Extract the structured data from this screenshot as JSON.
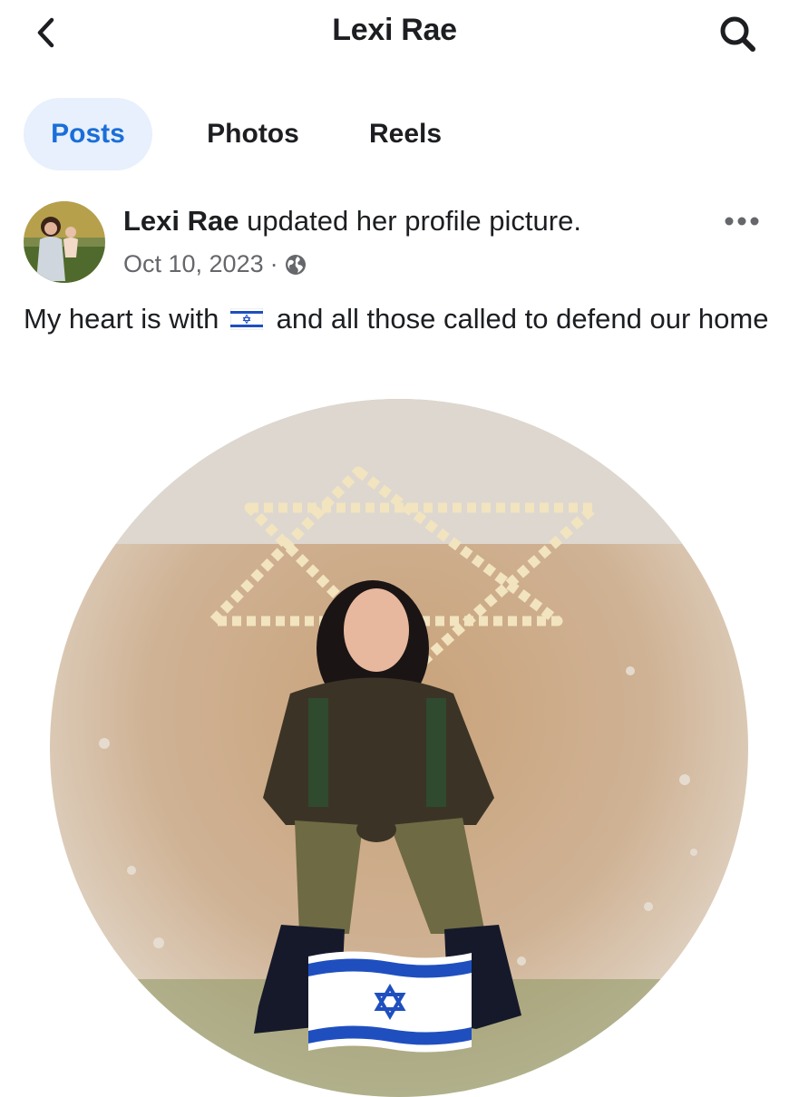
{
  "header": {
    "title": "Lexi Rae",
    "back_icon": "chevron-left-icon",
    "search_icon": "search-icon"
  },
  "tabs": [
    {
      "label": "Posts",
      "active": true
    },
    {
      "label": "Photos",
      "active": false
    },
    {
      "label": "Reels",
      "active": false
    }
  ],
  "post": {
    "author": "Lexi Rae",
    "action": "updated her profile picture.",
    "date": "Oct 10, 2023",
    "separator": "·",
    "audience_icon": "globe-icon",
    "more_icon": "more-horizontal-icon",
    "text_before_flag": "My heart is with",
    "flag_emoji": "israel-flag-icon",
    "text_after_flag": "and all those called to defend our home"
  },
  "colors": {
    "accent": "#1a6ed8",
    "active_tab_bg": "#e7f0fc",
    "secondary_text": "#65676b"
  }
}
